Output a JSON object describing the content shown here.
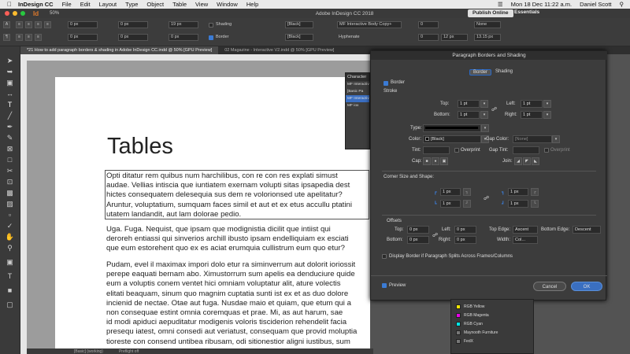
{
  "menubar": {
    "app": "InDesign CC",
    "items": [
      "File",
      "Edit",
      "Layout",
      "Type",
      "Object",
      "Table",
      "View",
      "Window",
      "Help"
    ],
    "datetime": "Mon 18 Dec  11:22 a.m.",
    "user": "Daniel Scott"
  },
  "appbar": {
    "window_title": "Adobe InDesign CC 2018",
    "zoom": "50%",
    "publish": "Publish Online",
    "workspace": "Essentials"
  },
  "control": {
    "f1": "0 px",
    "f2": "0 px",
    "f3": "0 px",
    "f4": "0 px",
    "f5": "19 px",
    "f6": "0 px",
    "shading_label": "Shading",
    "border_label": "Border",
    "black1": "[Black]",
    "black2": "[Black]",
    "style": "MF Interactive Body Copy+",
    "none": "None",
    "hyphenate": "Hyphenate",
    "f7": "0",
    "f8": "0",
    "f9": "12 px",
    "f10": "0 px",
    "f11": "13.15 px"
  },
  "tabs": [
    {
      "label": "*21 How to add paragraph borders & shading in Adobe InDesign CC.indd @ 50% [GPU Preview]"
    },
    {
      "label": "02 Magazine - Interactive V2.indd @ 50% [GPU Preview]"
    }
  ],
  "document": {
    "heading": "Tables",
    "para1": "Opti ditatur rem quibus num harchilibus, con re con res explati simust\naudae. Vellias intiscia que iuntiatem exernam volupti sitas ipsapedia dest\nhictes consequatem delesequia sus dem re volorionsed ute apelitatur?\nAruntur, voluptatium, sumquam faces simil et aut et ex etus accullu ptatini\nutatem landandit, aut lam dolorae pedio.",
    "para2": "Uga. Fuga. Nequist, que ipsam que modignistia dicilit que intiist qui\nderoreh entiassi qui sinverios archill ibusto ipsam endelliquiam ex esciati\nque eum estorehent quo ex es aciat erumquia cullistrum eum quo etur?",
    "para3": "Pudam, evel il maximax impori dolo etur ra siminverrum aut dolorit ioriossit\nperepe eaquati bernam abo. Ximustorrum sum apelis ea denduciure quide\neum a voluptis conem ventet hici omniam voluptatur alit, ature volectis\nelitati beaquam, sinum quo magnim cuptatia sunti ist ex et as duo dolore\nincienid de nectae. Otae aut fuga. Nusdae maio et quiam, que etum qui a\nnon consequae estint omnia coremquas et prae. Mi, as aut harum, sae\nid modi apiduci aepuditatur modigenis voloris tisciderion rehendelit facia\npresequ iatest, omni consedi aut veriatust, consequam que provid moluptia\ntioreste con consend untibea ribusam, odi sitionestior aligni iustibus, sum"
  },
  "status": {
    "style": "[Basic] (working)",
    "preflight": "Preflight off"
  },
  "char_panel": {
    "title": "Character",
    "items": [
      "MF Interactive",
      "[Basic Pa",
      "MF Interactive Bo",
      "MF iox"
    ]
  },
  "dialog": {
    "title": "Paragraph Borders and Shading",
    "tab_border": "Border",
    "tab_shading": "Shading",
    "border_label": "Border",
    "stroke_label": "Stroke",
    "top_label": "Top:",
    "top_val": "1 pt",
    "left_label": "Left:",
    "left_val": "1 pt",
    "bottom_label": "Bottom:",
    "bottom_val": "1 pt",
    "right_label": "Right:",
    "right_val": "1 pt",
    "type_label": "Type:",
    "color_label": "Color:",
    "color_val": "[Black]",
    "gap_color_label": "Gap Color:",
    "gap_color_val": "[None]",
    "tint_label": "Tint:",
    "overprint": "Overprint",
    "gap_tint_label": "Gap Tint:",
    "overprint2": "Overprint",
    "cap_label": "Cap:",
    "join_label": "Join:",
    "corner_label": "Corner Size and Shape:",
    "c1": "1 px",
    "c2": "1 px",
    "c3": "1 px",
    "c4": "1 px",
    "offsets_label": "Offsets",
    "otop_label": "Top:",
    "otop_val": "0 px",
    "oleft_label": "Left:",
    "oleft_val": "0 px",
    "obottom_label": "Bottom:",
    "obottom_val": "0 px",
    "oright_label": "Right:",
    "oright_val": "0 px",
    "top_edge_label": "Top Edge:",
    "top_edge_val": "Ascent",
    "bottom_edge_label": "Bottom Edge:",
    "bottom_edge_val": "Descent",
    "width_label": "Width:",
    "width_val": "Col...",
    "display_label": "Display Border if Paragraph Splits Across Frames/Columns",
    "preview": "Preview",
    "cancel": "Cancel",
    "ok": "OK"
  },
  "swatches": [
    {
      "name": "RGB Yellow",
      "color": "#f2e600"
    },
    {
      "name": "RGB Magenta",
      "color": "#e800e8"
    },
    {
      "name": "RGB Cyan",
      "color": "#00e5e5"
    },
    {
      "name": "Maynooth Furniture",
      "color": "#777777"
    },
    {
      "name": "FedX",
      "color": "#777777"
    }
  ],
  "colors": {
    "accent": "#3b7bd4",
    "publish_bg": "#e0e0e0"
  }
}
